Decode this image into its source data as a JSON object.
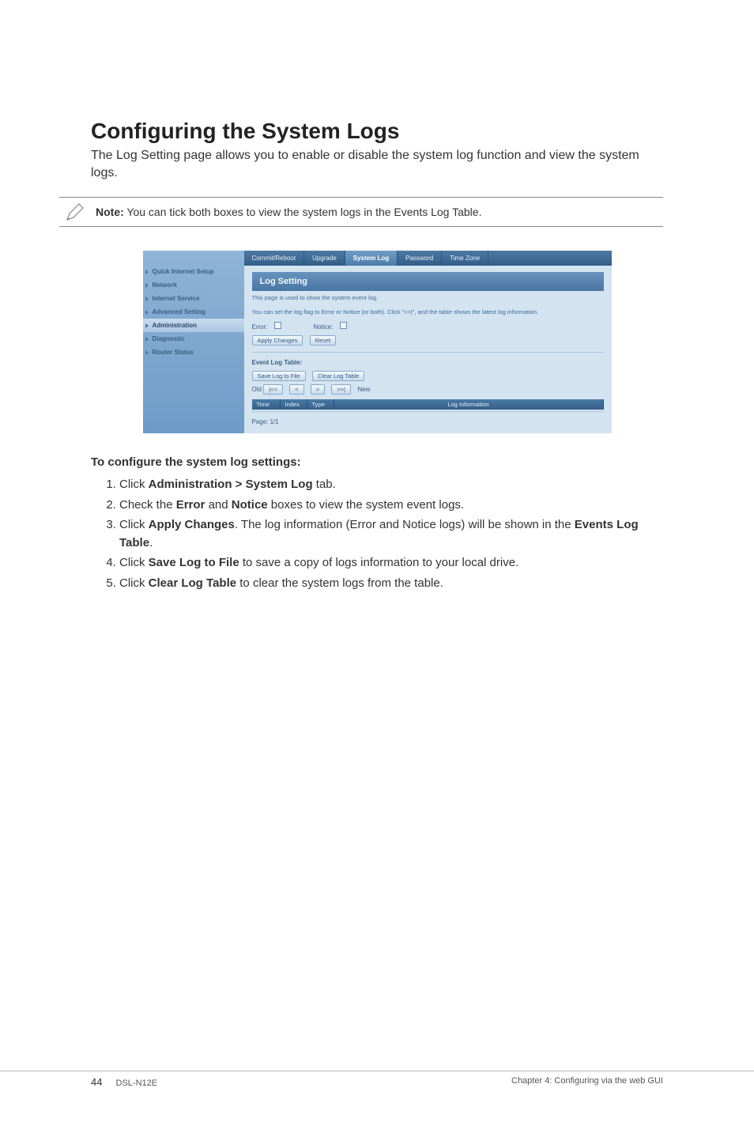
{
  "heading": "Configuring the System Logs",
  "intro": "The Log Setting page allows you to enable or disable the system log function and view the system logs.",
  "note_label": "Note:",
  "note_text": " You can tick both boxes to view the system logs in the Events Log Table.",
  "router": {
    "sidebar": [
      "Quick Internet Setup",
      "Network",
      "Internet Service",
      "Advanced Setting",
      "Administration",
      "Diagnostic",
      "Router Status"
    ],
    "active_sidebar_index": 4,
    "tabs": [
      "Commit/Reboot",
      "Upgrade",
      "System Log",
      "Password",
      "Time Zone"
    ],
    "active_tab_index": 2,
    "panel_title": "Log Setting",
    "desc1": "This page is used to show the system event log.",
    "desc2": "You can set the log flag to Error or Notice (or both). Click \">>|\", and the table shows the latest log information.",
    "error_label": "Error:",
    "notice_label": "Notice:",
    "apply_btn": "Apply Changes",
    "reset_btn": "Reset",
    "event_table_label": "Event Log Table:",
    "save_log_btn": "Save Log to File",
    "clear_log_btn": "Clear Log Table",
    "old_label": "Old",
    "new_label": "New",
    "nav_first": "|<<",
    "nav_prev": "<",
    "nav_next": ">",
    "nav_last": ">>|",
    "th_time": "Time",
    "th_index": "Index",
    "th_type": "Type",
    "th_info": "Log Information",
    "page_info": "Page: 1/1"
  },
  "instr_heading": "To configure the system log settings:",
  "steps": {
    "s1a": "Click ",
    "s1b": "Administration > System Log",
    "s1c": " tab.",
    "s2a": "Check the ",
    "s2b": "Error",
    "s2c": " and ",
    "s2d": "Notice",
    "s2e": " boxes to view the system event logs.",
    "s3a": "Click ",
    "s3b": "Apply Changes",
    "s3c": ". The log information (Error and Notice logs) will be shown in the ",
    "s3d": "Events Log Table",
    "s3e": ".",
    "s4a": "Click ",
    "s4b": "Save Log to File",
    "s4c": " to save a copy of logs information to your local drive.",
    "s5a": "Click ",
    "s5b": "Clear Log Table",
    "s5c": " to clear the system logs from the table."
  },
  "footer": {
    "page_num": "44",
    "model": "DSL-N12E",
    "chapter": "Chapter 4: Configuring via the web GUI"
  }
}
